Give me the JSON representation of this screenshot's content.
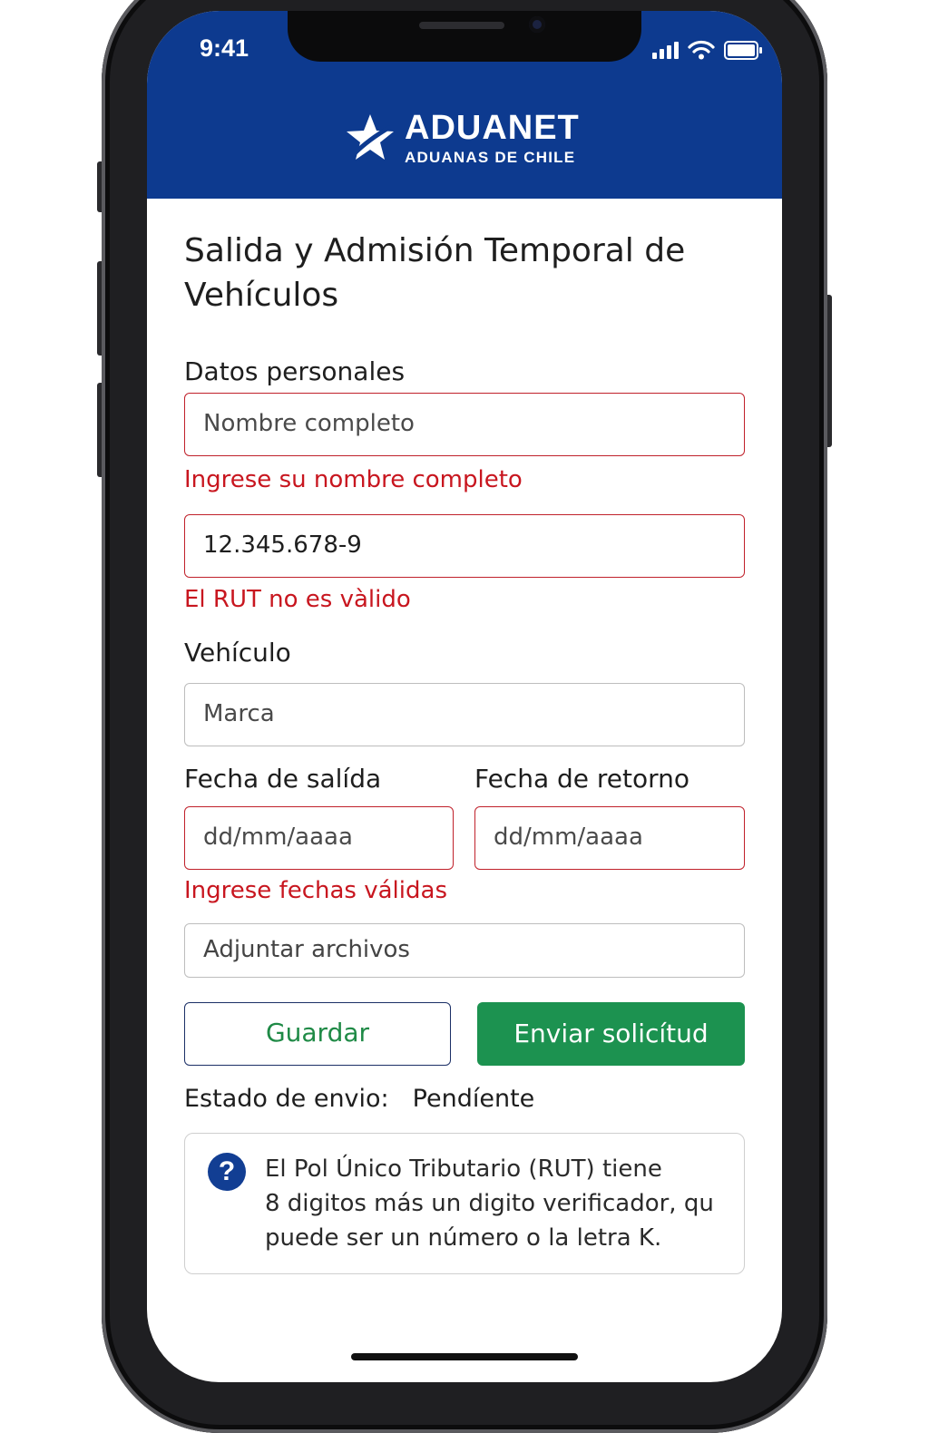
{
  "status_bar": {
    "time": "9:41"
  },
  "header": {
    "logo_title": "ADUANET",
    "logo_subtitle": "ADUANAS DE CHILE",
    "bg_color": "#0d3a8f"
  },
  "form": {
    "title": "Salida y Admisión Temporal de Vehículos",
    "section_personal": "Datos personales",
    "name_field": {
      "placeholder": "Nombre completo",
      "value": ""
    },
    "name_error": "Ingrese su nombre completo",
    "rut_field": {
      "placeholder": "",
      "value": "12.345.678-9"
    },
    "rut_error": "El RUT no es vàlido",
    "section_vehicle": "Vehículo",
    "brand_field": {
      "placeholder": "Marca",
      "value": ""
    },
    "departure_label": "Fecha de salída",
    "return_label": "Fecha de retorno",
    "departure_field": {
      "placeholder": "dd/mm/aaaa",
      "value": ""
    },
    "return_field": {
      "placeholder": "dd/mm/aaaa",
      "value": ""
    },
    "dates_error": "Ingrese fechas válidas",
    "attach_label": "Adjuntar archivos",
    "save_button": "Guardar",
    "submit_button": "Enviar solicítud",
    "status_label": "Estado de envio:",
    "status_value": "Pendíente"
  },
  "info_box": {
    "icon": "help-icon",
    "line1": "El Pol Único Tributario (RUT) tiene",
    "line2": "8 digitos más un digito verificador, qu",
    "line3": "puede ser un número o la letra K."
  },
  "colors": {
    "error": "#c8161f",
    "primary_green": "#1c9250",
    "brand_blue": "#0d3a8f"
  }
}
